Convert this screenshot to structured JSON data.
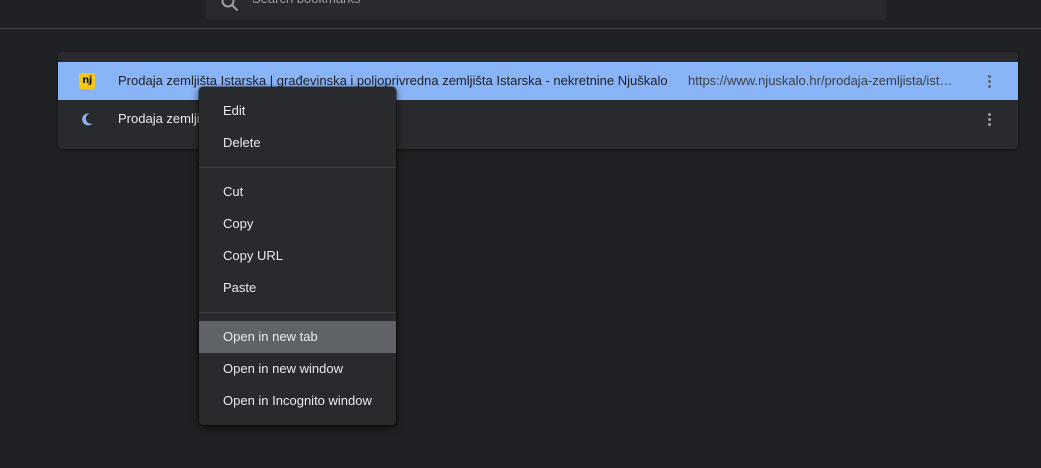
{
  "search": {
    "placeholder": "Search bookmarks"
  },
  "bookmarks": [
    {
      "title": "Prodaja zemljišta Istarska | građevinska i poljoprivredna zemljišta Istarska - nekretnine Njuškalo",
      "url": "https://www.njuskalo.hr/prodaja-zemljista/istarska",
      "favicon": "nj",
      "selected": true
    },
    {
      "title": "Prodaja zemlji",
      "url": "",
      "favicon": "moon-icon",
      "selected": false
    }
  ],
  "context_menu": {
    "items": [
      {
        "label": "Edit"
      },
      {
        "label": "Delete"
      },
      {
        "label": "Cut"
      },
      {
        "label": "Copy"
      },
      {
        "label": "Copy URL"
      },
      {
        "label": "Paste"
      },
      {
        "label": "Open in new tab",
        "highlighted": true
      },
      {
        "label": "Open in new window"
      },
      {
        "label": "Open in Incognito window"
      }
    ]
  },
  "colors": {
    "background": "#202124",
    "surface": "#292a2d",
    "selected_row": "#8ab4f8",
    "menu_highlight": "#5f6368",
    "favicon_nj": "#f5c518",
    "favicon_moon": "#8ab4f8"
  }
}
